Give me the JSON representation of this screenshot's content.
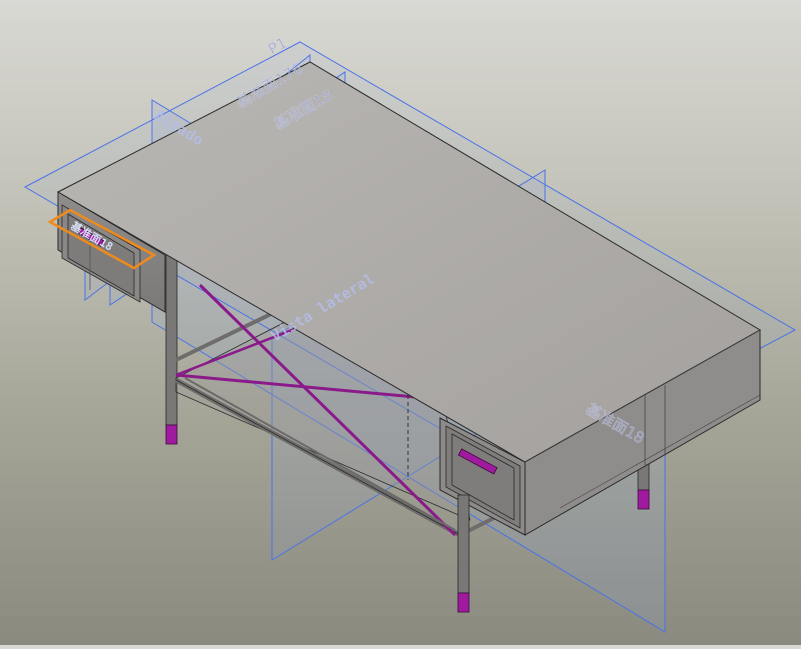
{
  "viewport": {
    "background_top": "#d9d9d4",
    "background_bottom": "#8a8a80"
  },
  "colors": {
    "plane_outline": "#4a73e8",
    "plane_fill": "#8fa6d8",
    "selection": "#f08a1c",
    "accent_parts": "#a01aa0",
    "body_light": "#a9a6a3",
    "body_dark": "#6f6d6b",
    "edges": "#2a2a2a"
  },
  "planes": {
    "plane_176": "基准面176",
    "plane_18": "基准面18",
    "plane_top_short": "P1",
    "plane_alzado": "Alzado",
    "plane_vista_lateral": "Vista lateral",
    "plane_18_right": "基准面18",
    "plane_selected": "基准面18"
  }
}
